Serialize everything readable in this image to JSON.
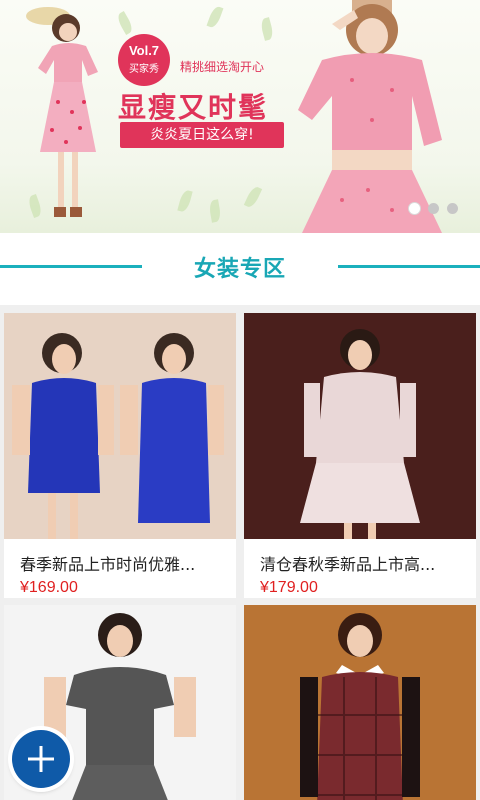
{
  "banner": {
    "vol_number": "Vol.7",
    "vol_sub": "买家秀",
    "slogan_small": "精挑细选淘开心",
    "slogan_main": "显瘦又时髦",
    "slogan_tag": "炎炎夏日这么穿!",
    "dots_count": 3,
    "active_dot": 0,
    "accent_color": "#e0345a"
  },
  "section": {
    "title": "女装专区",
    "color": "#19a7b5"
  },
  "products": [
    {
      "name": "春季新品上市时尚优雅...",
      "price": "¥169.00",
      "image": "blue-dress-photo"
    },
    {
      "name": "清仓春秋季新品上市高...",
      "price": "¥179.00",
      "image": "lace-dress-photo"
    },
    {
      "name": "",
      "price": "",
      "image": "grey-dress-photo"
    },
    {
      "name": "",
      "price": "",
      "image": "plaid-dress-photo"
    }
  ],
  "fab": {
    "icon": "plus-icon"
  }
}
